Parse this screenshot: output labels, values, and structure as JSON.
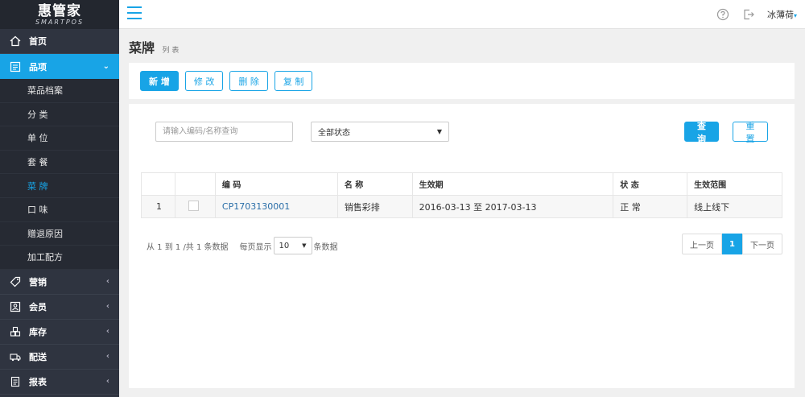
{
  "sidebar": {
    "logo": {
      "brand": "惠管家",
      "sub": "SMARTPOS"
    },
    "items": [
      {
        "label": "首页",
        "icon": "home-icon"
      },
      {
        "label": "品项",
        "icon": "list-icon",
        "chevron": "⌄"
      },
      {
        "label": "营销",
        "icon": "tag-icon",
        "chevron": "‹"
      },
      {
        "label": "会员",
        "icon": "member-card-icon",
        "chevron": "‹"
      },
      {
        "label": "库存",
        "icon": "warehouse-icon",
        "chevron": "‹"
      },
      {
        "label": "配送",
        "icon": "truck-icon",
        "chevron": "‹"
      },
      {
        "label": "报表",
        "icon": "report-icon",
        "chevron": "‹"
      }
    ],
    "sub_items": [
      "菜品档案",
      "分 类",
      "单 位",
      "套 餐",
      "菜 牌",
      "口 味",
      "赠退原因",
      "加工配方"
    ]
  },
  "topbar": {
    "user": "冰薄荷",
    "caret": "▾"
  },
  "header": {
    "title": "菜牌",
    "subtitle": "列 表"
  },
  "toolbar": {
    "new": "新 增",
    "edit": "修 改",
    "delete": "删 除",
    "copy": "复 制"
  },
  "filters": {
    "search_placeholder": "请输入编码/名称查询",
    "status_select": "全部状态",
    "query": "查 询",
    "reset": "重 置"
  },
  "table": {
    "headers": [
      "",
      "",
      "编 码",
      "名 称",
      "生效期",
      "状 态",
      "生效范围"
    ],
    "rows": [
      {
        "index": "1",
        "code": "CP1703130001",
        "name": "销售彩排",
        "period": "2016-03-13 至 2017-03-13",
        "status": "正 常",
        "scope": "线上线下"
      }
    ]
  },
  "pagination": {
    "info": "从 1 到 1 /共 1 条数据",
    "per_page_label": "每页显示",
    "per_page": "10",
    "per_page_suffix": "条数据",
    "prev": "上一页",
    "current": "1",
    "next": "下一页"
  },
  "colors": {
    "accent": "#18a4e6",
    "sidebar": "#2f3440"
  }
}
